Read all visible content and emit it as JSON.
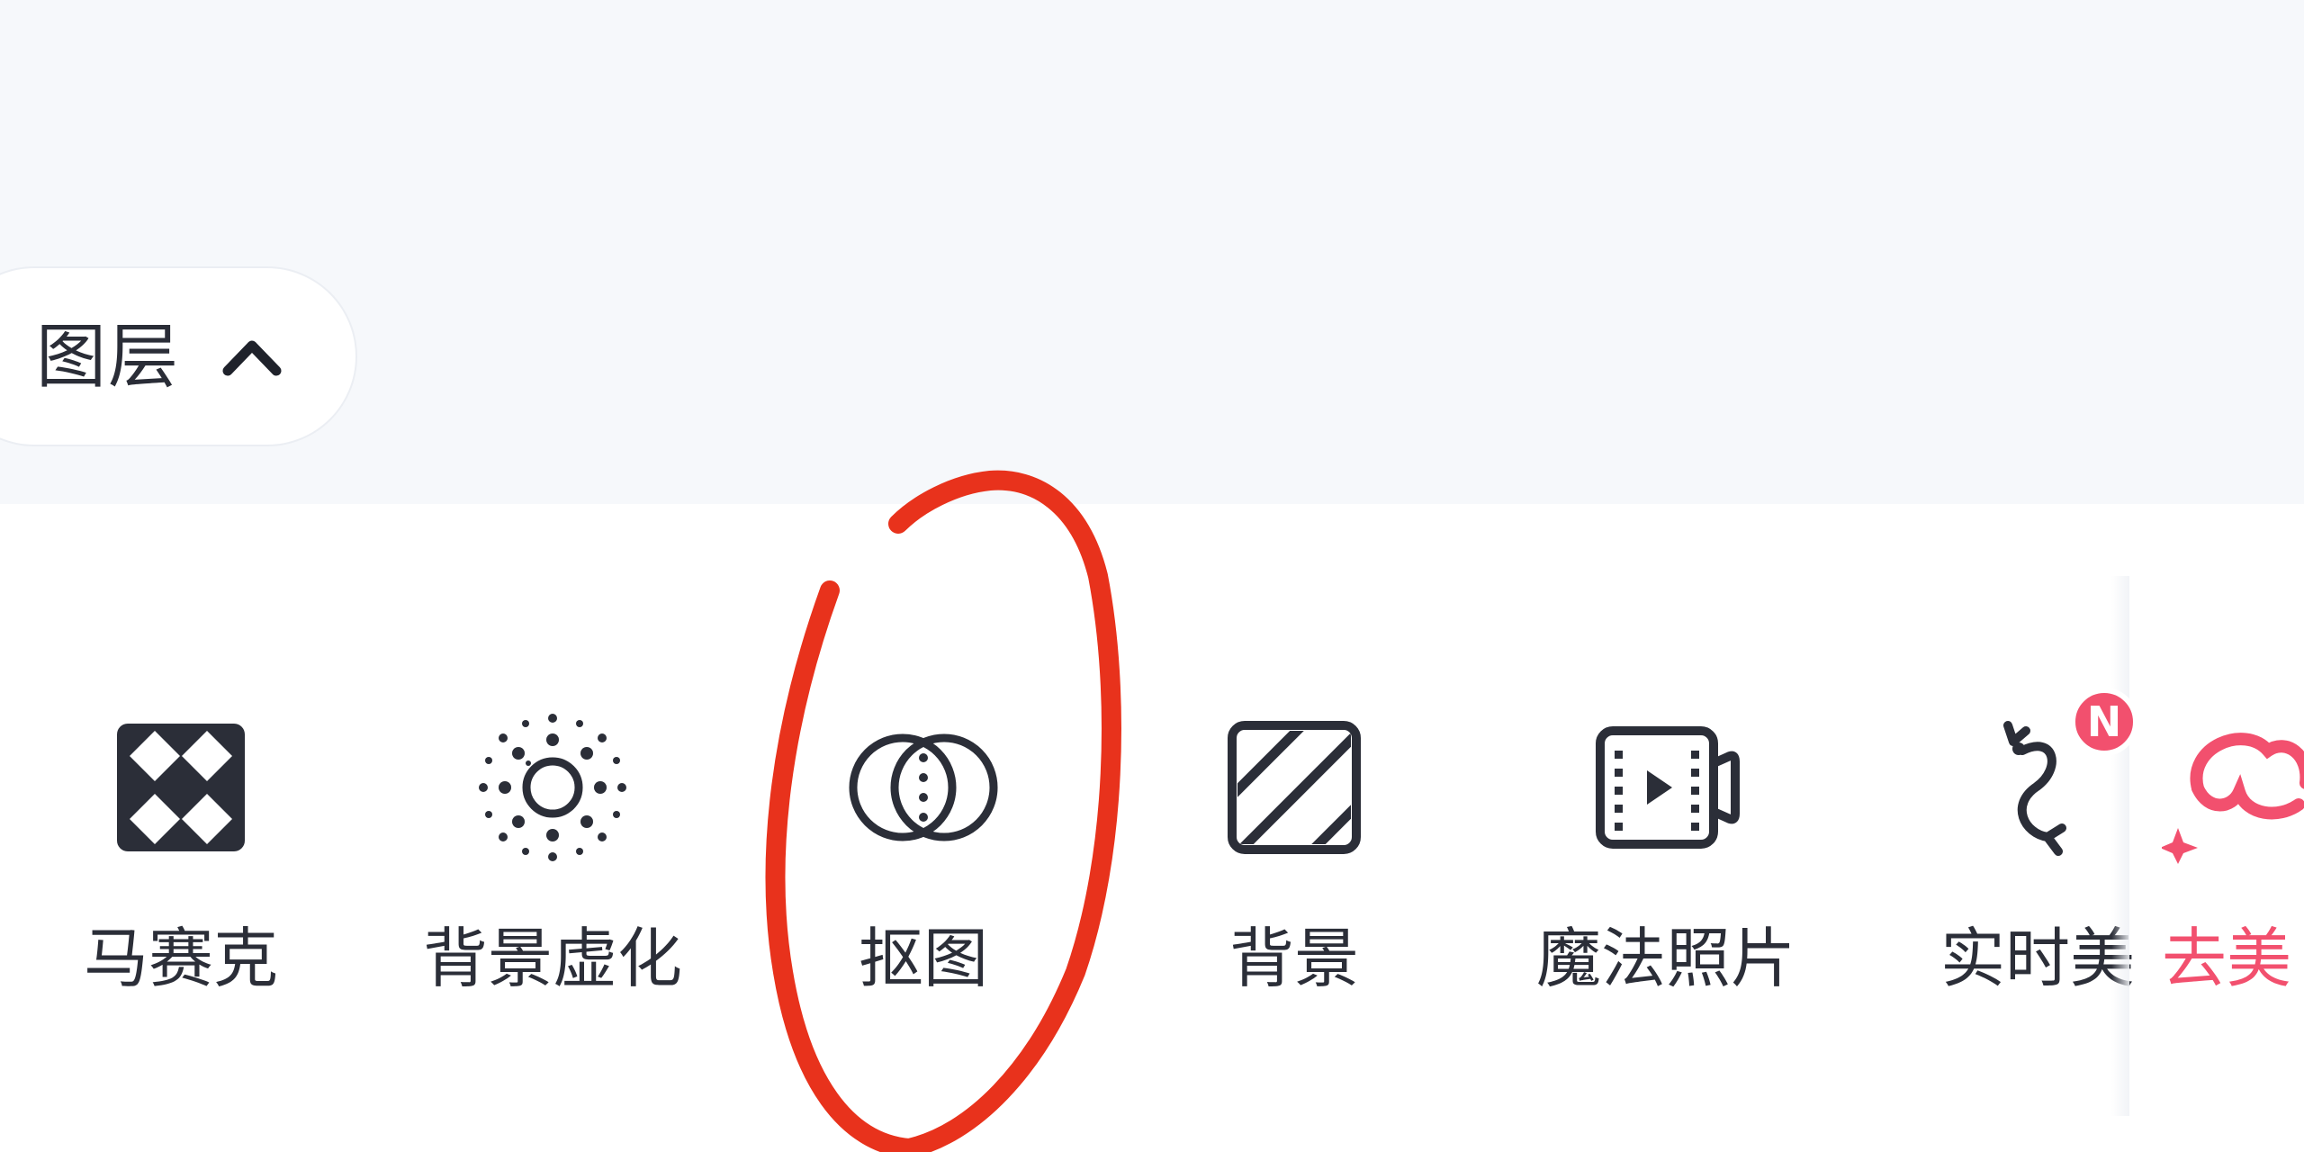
{
  "layers_button": {
    "label": "图层",
    "icon": "chevron-up-icon"
  },
  "tools": [
    {
      "id": "mosaic",
      "label": "马赛克",
      "icon": "mosaic-icon"
    },
    {
      "id": "background-blur",
      "label": "背景虚化",
      "icon": "background-blur-icon"
    },
    {
      "id": "cutout",
      "label": "抠图",
      "icon": "cutout-icon"
    },
    {
      "id": "background",
      "label": "背景",
      "icon": "background-icon"
    },
    {
      "id": "magic-photo",
      "label": "魔法照片",
      "icon": "magic-photo-icon"
    },
    {
      "id": "live-beauty",
      "label": "实时美",
      "icon": "live-beauty-icon",
      "badge": "N"
    },
    {
      "id": "remove-beauty",
      "label": "去美",
      "icon": "remove-beauty-icon"
    }
  ],
  "colors": {
    "text": "#2b2e38",
    "accent": "#f2506e",
    "annotation": "#e8321c"
  }
}
